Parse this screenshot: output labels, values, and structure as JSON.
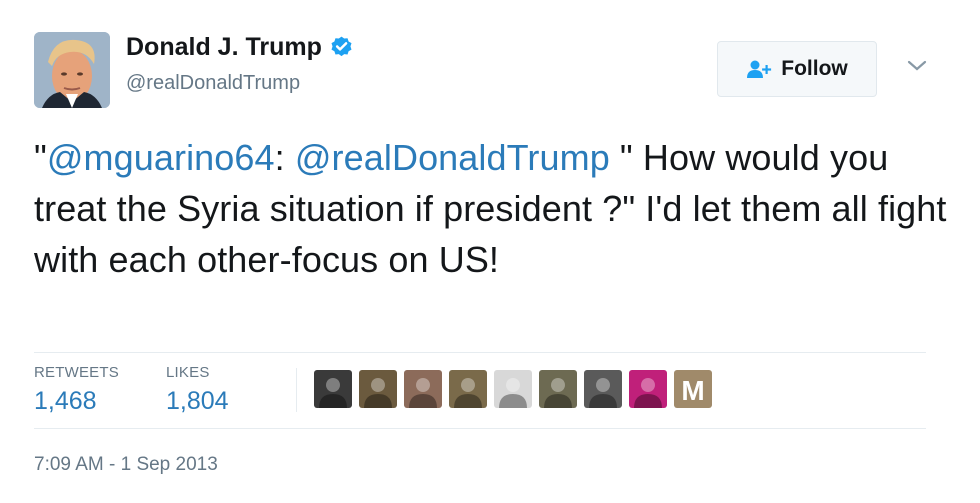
{
  "author": {
    "name": "Donald J. Trump",
    "handle": "@realDonaldTrump",
    "avatar_icon": "profile-photo",
    "verified_icon": "verified-badge-icon"
  },
  "follow_button": {
    "label": "Follow",
    "icon": "add-user-icon"
  },
  "menu_icon": "chevron-down-icon",
  "tweet": {
    "quote_open": "\"",
    "mention1": "@mguarino64",
    "colon": ": ",
    "mention2": "@realDonaldTrump",
    "text": " \" How would you treat the Syria situation if president ?\" I'd let them all fight with each other-focus on US!"
  },
  "stats": {
    "retweets_label": "RETWEETS",
    "retweets_value": "1,468",
    "likes_label": "LIKES",
    "likes_value": "1,804"
  },
  "liker_avatars": [
    {
      "icon": "user-avatar",
      "color": "#3a3a3a"
    },
    {
      "icon": "user-avatar",
      "color": "#6b5a3e"
    },
    {
      "icon": "user-avatar",
      "color": "#8c6b5a"
    },
    {
      "icon": "user-avatar",
      "color": "#7a6a4a"
    },
    {
      "icon": "user-avatar",
      "color": "#d8d8d8"
    },
    {
      "icon": "user-avatar",
      "color": "#6d6a52"
    },
    {
      "icon": "user-avatar",
      "color": "#5a5a5a"
    },
    {
      "icon": "user-avatar",
      "color": "#c0207a"
    },
    {
      "icon": "user-avatar-m",
      "color": "#a08a6a",
      "letter": "M"
    }
  ],
  "timestamp": "7:09 AM - 1 Sep 2013",
  "colors": {
    "link": "#2b7bb9",
    "muted": "#657786",
    "verified": "#1da1f2"
  }
}
